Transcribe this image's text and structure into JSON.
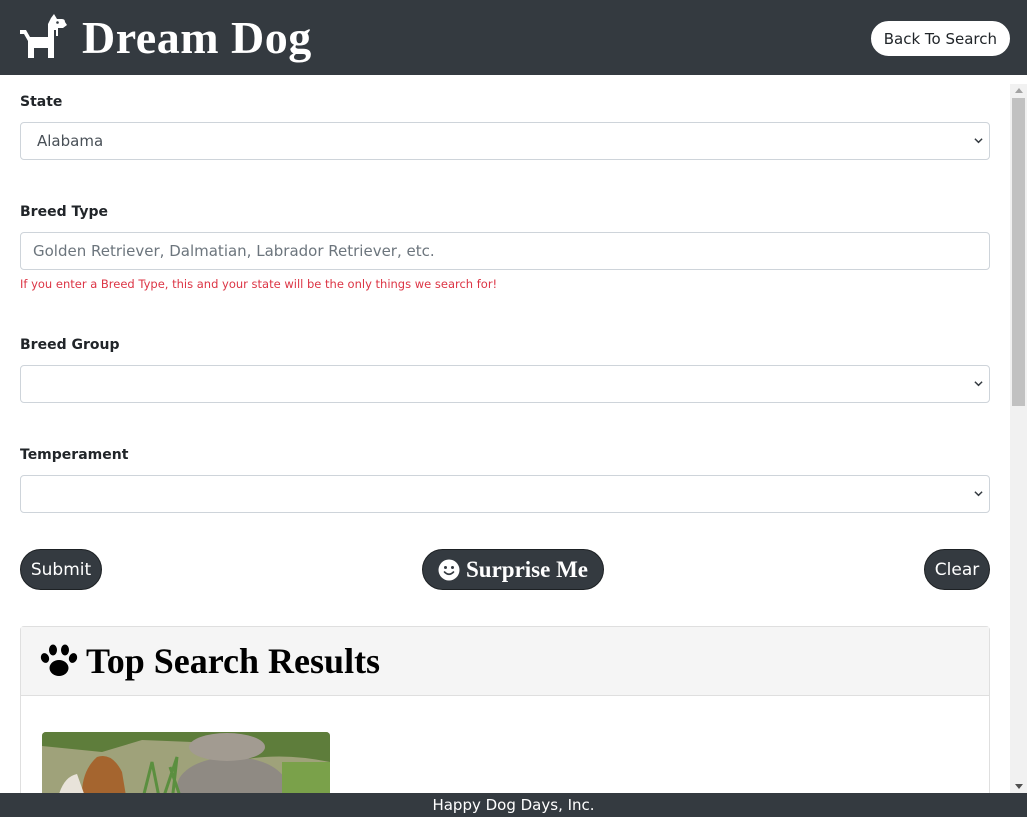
{
  "header": {
    "brand": "Dream Dog",
    "back_button": "Back To Search"
  },
  "form": {
    "state": {
      "label": "State",
      "value": "Alabama"
    },
    "breed_type": {
      "label": "Breed Type",
      "placeholder": "Golden Retriever, Dalmatian, Labrador Retriever, etc.",
      "help": "If you enter a Breed Type, this and your state will be the only things we search for!"
    },
    "breed_group": {
      "label": "Breed Group",
      "value": ""
    },
    "temperament": {
      "label": "Temperament",
      "value": ""
    },
    "buttons": {
      "submit": "Submit",
      "surprise": "Surprise Me",
      "clear": "Clear"
    }
  },
  "results": {
    "title": "Top Search Results"
  },
  "footer": {
    "text": "Happy Dog Days, Inc."
  },
  "icons": {
    "brand": "dog-icon",
    "surprise": "smile-icon",
    "results": "paw-icon",
    "select_arrow": "chevron-down-icon"
  },
  "colors": {
    "navbar": "#343a40",
    "help_text": "#dc3545"
  }
}
